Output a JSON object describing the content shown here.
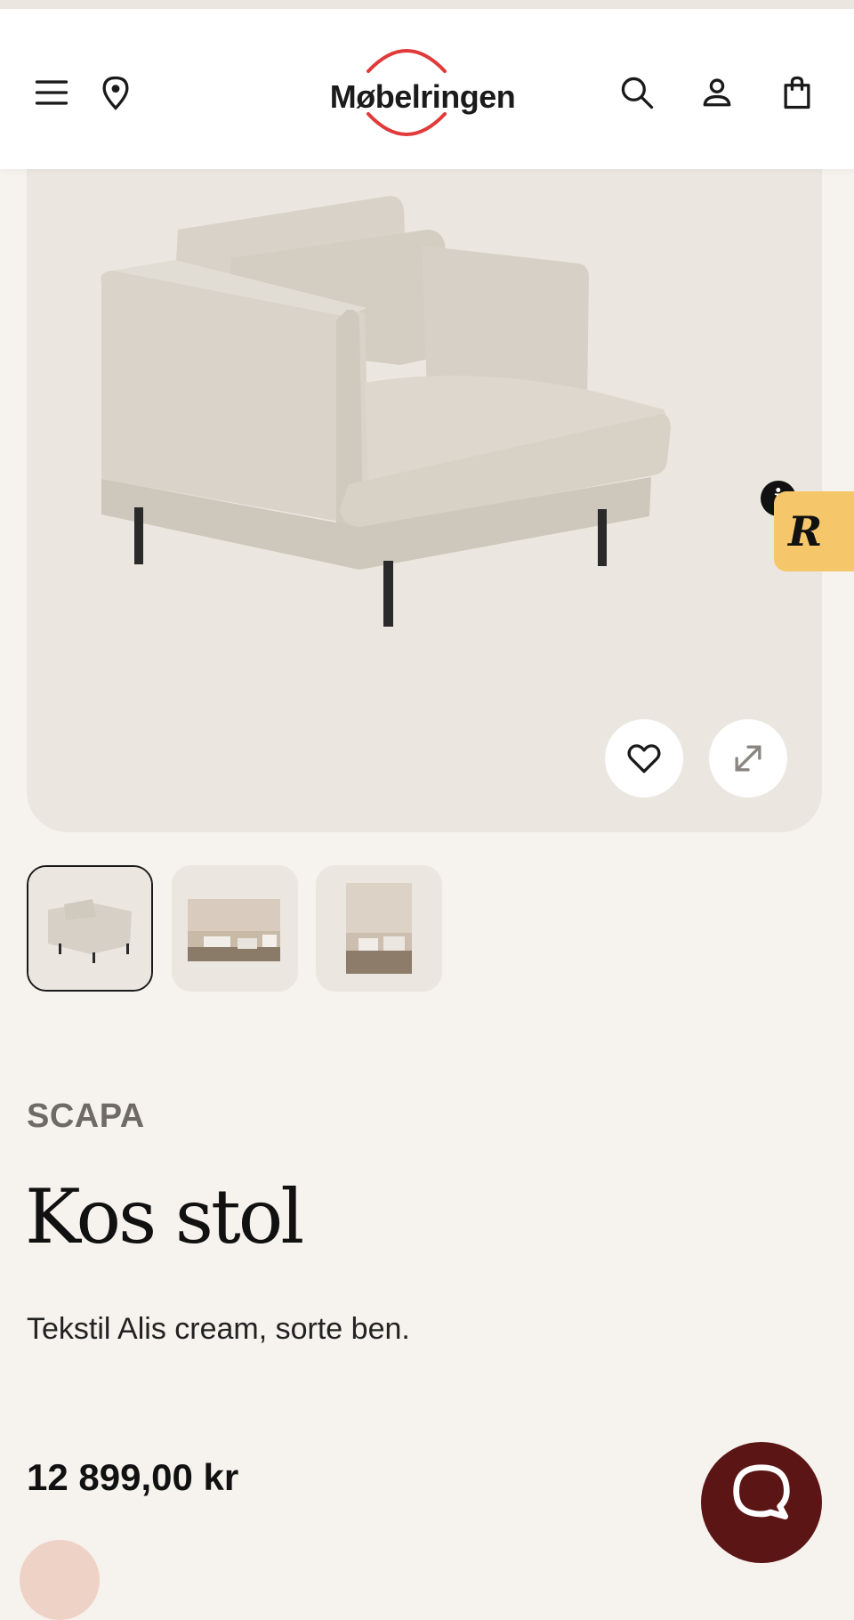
{
  "header": {
    "logo_text": "Møbelringen",
    "icons": [
      "menu-icon",
      "location-pin-icon",
      "search-icon",
      "user-icon",
      "shopping-bag-icon"
    ],
    "logo_arc_color": "#e03a3a"
  },
  "gallery": {
    "buttons": [
      "heart-icon",
      "expand-icon"
    ],
    "thumbnails": [
      "thumbnail-chair",
      "thumbnail-room-1",
      "thumbnail-room-2"
    ],
    "active_thumbnail": 1
  },
  "widget": {
    "letter": "R",
    "info": "i",
    "color": "#f5c76a"
  },
  "product": {
    "brand": "SCAPA",
    "title": "Kos stol",
    "description": "Tekstil Alis cream, sorte ben.",
    "price": "12 899,00 kr"
  },
  "chat": {
    "icon": "chat-bubble-icon",
    "color": "#5c1515"
  }
}
